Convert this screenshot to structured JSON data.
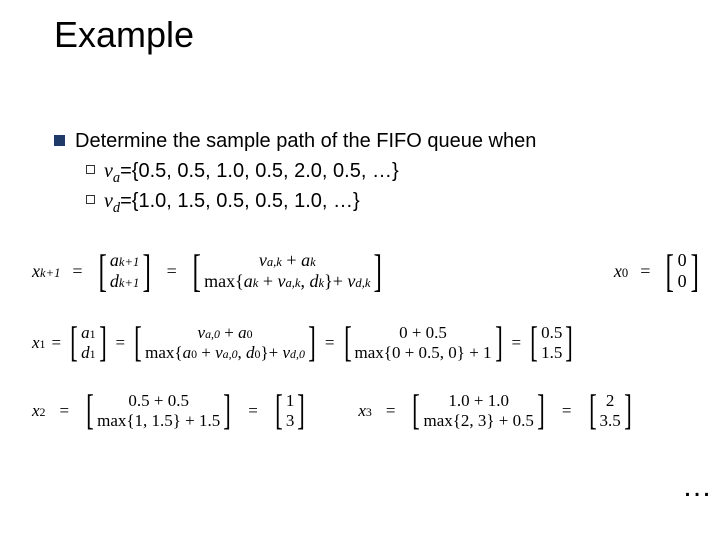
{
  "title": "Example",
  "bullet": "Determine the sample path of the FIFO queue when",
  "sub1": {
    "var": "v",
    "sub": "a",
    "rest": "={0.5, 0.5, 1.0, 0.5, 2.0, 0.5, …}"
  },
  "sub2": {
    "var": "v",
    "sub": "d",
    "rest": "={1.0, 1.5, 0.5, 0.5, 1.0, …}"
  },
  "eq": {
    "xk1": "x",
    "xk1_sub": "k+1",
    "ak1": "a",
    "ak1_sub": "k+1",
    "dk1": "d",
    "dk1_sub": "k+1",
    "top1": "v_{a,k} + a_k",
    "bot1_max": "max",
    "bot1_inside": "{a_k + v_{a,k}, d_k}",
    "bot1_tail": " + v_{d,k}",
    "x0": "x",
    "x0_sub": "0",
    "zero_top": "0",
    "zero_bot": "0",
    "x1": "x",
    "x1_sub": "1",
    "a1": "a",
    "a1_sub": "1",
    "d1": "d",
    "d1_sub": "1",
    "r2_top": "v_{a,0} + a_0",
    "r2_bot": "max{a_0 + v_{a,0}, d_0} + v_{d,0}",
    "r2b_top": "0 + 0.5",
    "r2b_bot": "max{0 + 0.5, 0} + 1",
    "r2c_top": "0.5",
    "r2c_bot": "1.5",
    "x2": "x",
    "x2_sub": "2",
    "r3a_top": "0.5 + 0.5",
    "r3a_bot": "max{1, 1.5} + 1.5",
    "r3b_top": "1",
    "r3b_bot": "3",
    "x3": "x",
    "x3_sub": "3",
    "r3c_top": "1.0 + 1.0",
    "r3c_bot": "max{2, 3} + 0.5",
    "r3d_top": "2",
    "r3d_bot": "3.5"
  },
  "ellipsis": "…"
}
